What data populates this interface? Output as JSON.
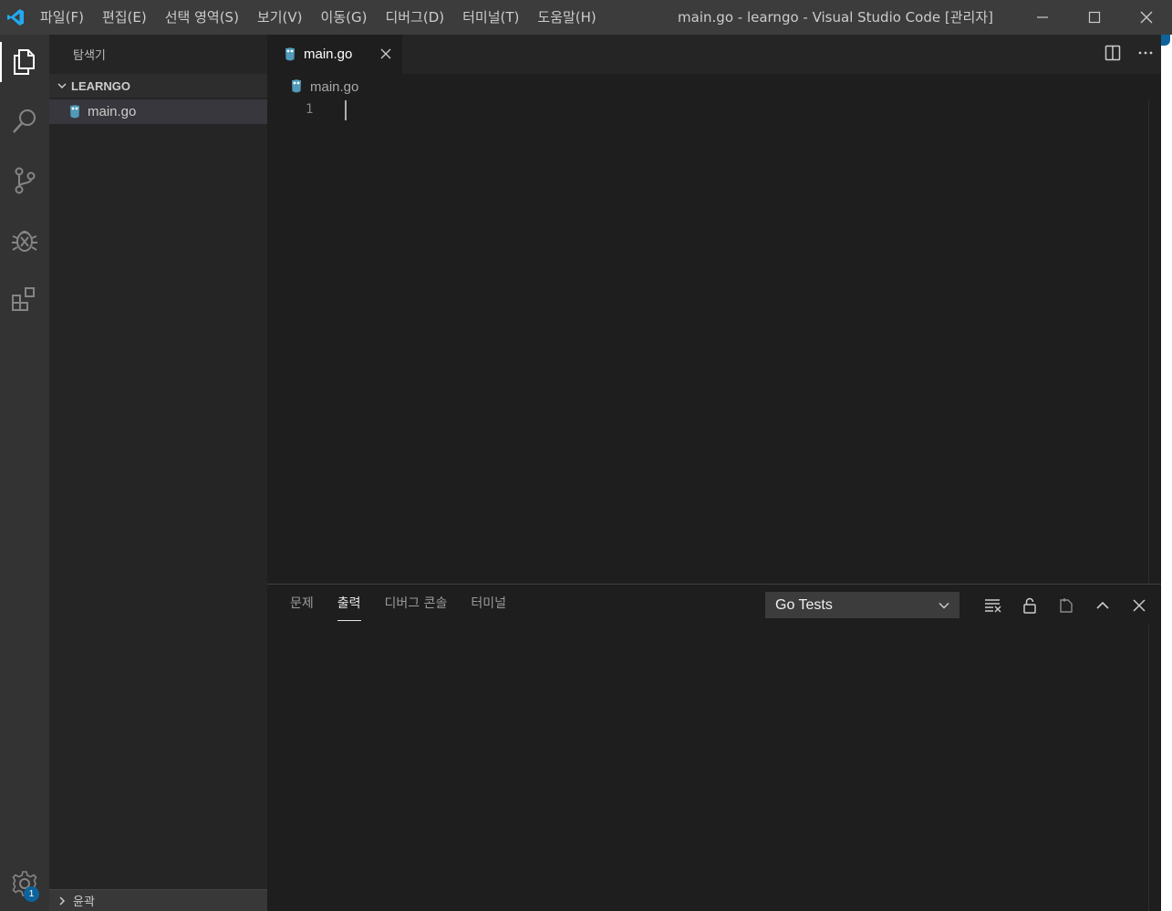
{
  "titlebar": {
    "menu": [
      "파일(F)",
      "편집(E)",
      "선택 영역(S)",
      "보기(V)",
      "이동(G)",
      "디버그(D)",
      "터미널(T)",
      "도움말(H)"
    ],
    "window_title": "main.go - learngo - Visual Studio Code [관리자]"
  },
  "activitybar": {
    "items": [
      "explorer-icon",
      "search-icon",
      "source-control-icon",
      "debug-icon",
      "extensions-icon"
    ],
    "settings_badge": "1"
  },
  "sidebar": {
    "title": "탐색기",
    "folder": "LEARNGO",
    "files": [
      "main.go"
    ],
    "outline_label": "윤곽"
  },
  "editor": {
    "tab_label": "main.go",
    "breadcrumb": "main.go",
    "line_numbers": [
      "1"
    ]
  },
  "panel": {
    "tabs": [
      "문제",
      "출력",
      "디버그 콘솔",
      "터미널"
    ],
    "active_tab": "출력",
    "output_channel": "Go Tests"
  },
  "colors": {
    "titlebar": "#3c3c3c",
    "activitybar": "#333333",
    "sidebar": "#252526",
    "editor": "#1e1e1e",
    "accent": "#0e639c",
    "go_icon": "#519aba"
  }
}
